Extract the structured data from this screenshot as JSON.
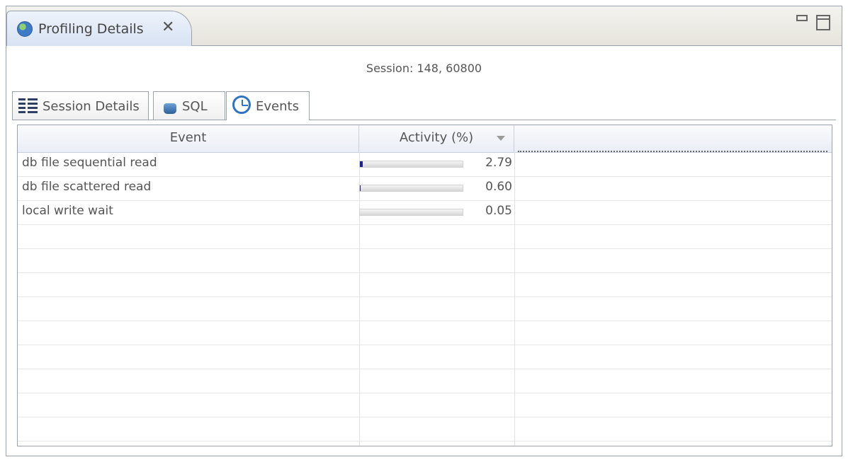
{
  "view": {
    "title": "Profiling Details",
    "close_glyph": "✕",
    "icons": {
      "view_icon": "globe-icon",
      "close": "close-icon",
      "minimize": "minimize-icon",
      "maximize": "maximize-icon"
    }
  },
  "session": {
    "line": "Session: 148, 60800"
  },
  "tabs": [
    {
      "label": "Session Details",
      "icon": "grid-icon"
    },
    {
      "label": "SQL",
      "icon": "database-icon"
    },
    {
      "label": "Events",
      "icon": "clock-icon",
      "active": true
    }
  ],
  "table": {
    "columns": [
      {
        "label": "Event"
      },
      {
        "label": "Activity (%)",
        "sorted": "descending"
      }
    ],
    "rows": [
      {
        "event": "db file sequential read",
        "activity": "2.79",
        "activity_value": 0.0279
      },
      {
        "event": "db file scattered read",
        "activity": "0.60",
        "activity_value": 0.006
      },
      {
        "event": "local write wait",
        "activity": "0.05",
        "activity_value": 0.0005
      }
    ],
    "empty_rows": 9
  },
  "colors": {
    "accent": "#2f73c5",
    "bar_fill": "#1d1f8f",
    "border": "#9aa3ad"
  }
}
